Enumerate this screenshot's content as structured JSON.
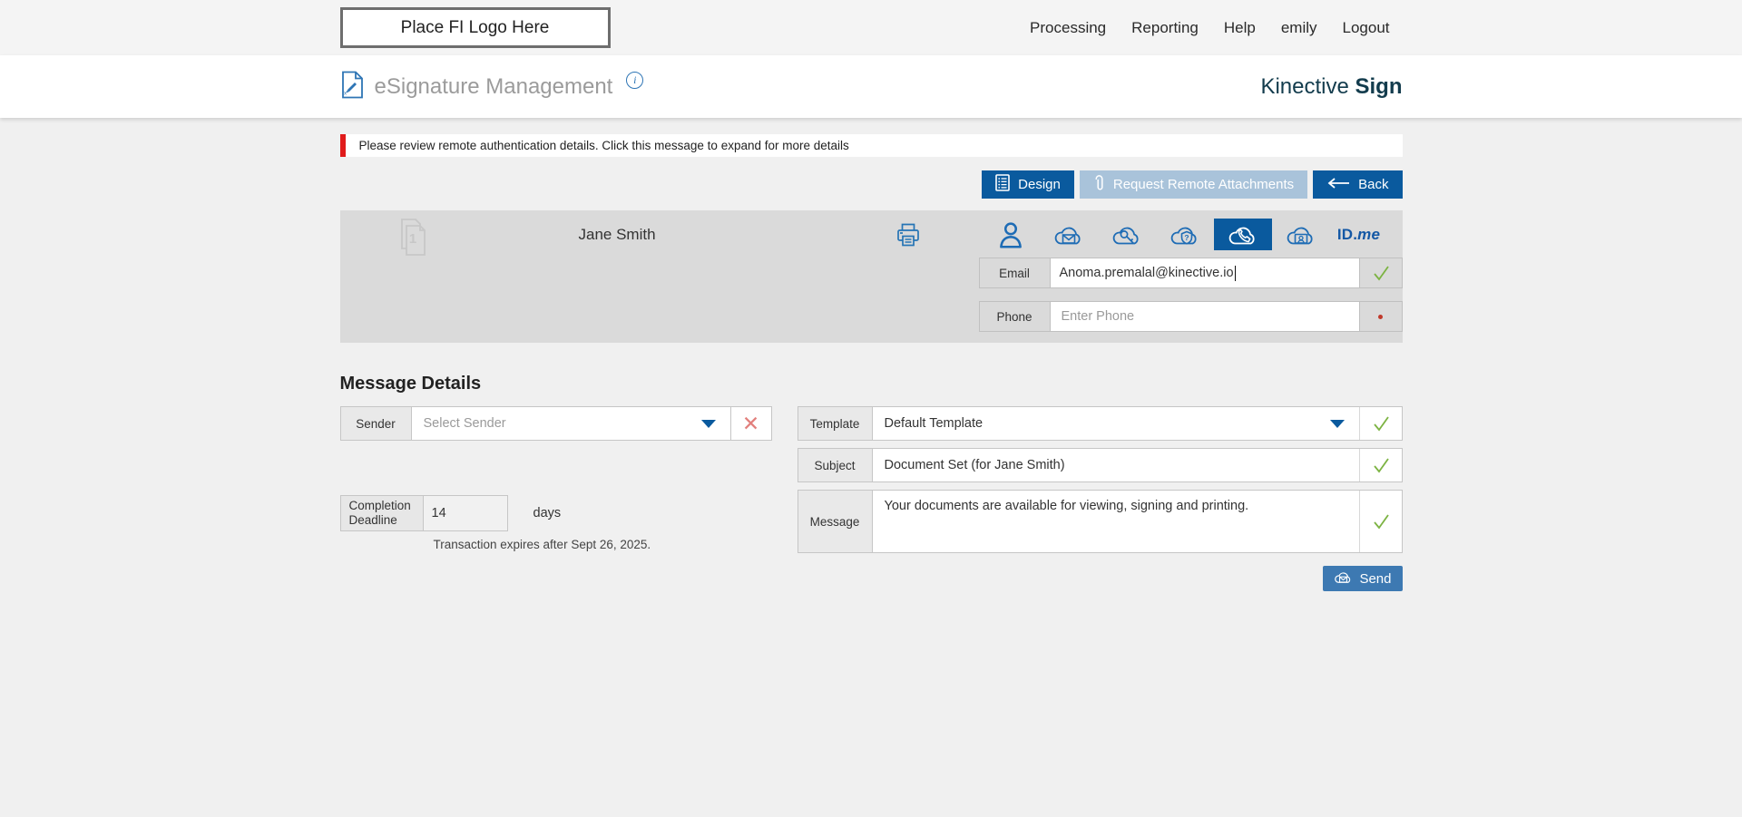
{
  "topbar": {
    "logo_placeholder": "Place FI Logo Here",
    "nav": [
      "Processing",
      "Reporting",
      "Help",
      "emily",
      "Logout"
    ]
  },
  "header": {
    "title": "eSignature Management",
    "brand_name": "Kinective",
    "brand_product": "Sign"
  },
  "alert": {
    "text": "Please review remote authentication details. Click this message to expand for more details"
  },
  "toolbar": {
    "design_label": "Design",
    "request_remote_attachments_label": "Request Remote Attachments",
    "back_label": "Back"
  },
  "recipient": {
    "name": "Jane Smith",
    "document_count": "1",
    "auth_methods": [
      "in-person",
      "email",
      "access-code",
      "security-question",
      "phone",
      "id-verification",
      "idme"
    ],
    "selected_auth_method": "phone",
    "idme": {
      "bold": "ID.",
      "italic": "me"
    },
    "email": {
      "label": "Email",
      "value": "Anoma.premalal@kinective.io"
    },
    "phone": {
      "label": "Phone",
      "placeholder": "Enter Phone"
    }
  },
  "message_details": {
    "heading": "Message Details",
    "sender": {
      "label": "Sender",
      "placeholder": "Select Sender"
    },
    "completion_deadline": {
      "label": "Completion Deadline",
      "value": "14",
      "unit": "days",
      "expires_note": "Transaction expires after Sept 26, 2025."
    },
    "template": {
      "label": "Template",
      "value": "Default Template"
    },
    "subject": {
      "label": "Subject",
      "value": "Document Set (for Jane Smith)"
    },
    "message": {
      "label": "Message",
      "value": "Your documents are available for viewing, signing and printing."
    },
    "send_label": "Send"
  },
  "colors": {
    "primary_blue": "#0a5a9e",
    "send_blue": "#3d79b2",
    "disabled_blue": "#a9c3da",
    "icon_blue": "#1e6cb5",
    "brand_teal": "#133c4d",
    "alert_red": "#e01b1b",
    "check_green": "#7cb342",
    "panel_gray": "#dadada",
    "page_gray": "#f0f0f0"
  }
}
